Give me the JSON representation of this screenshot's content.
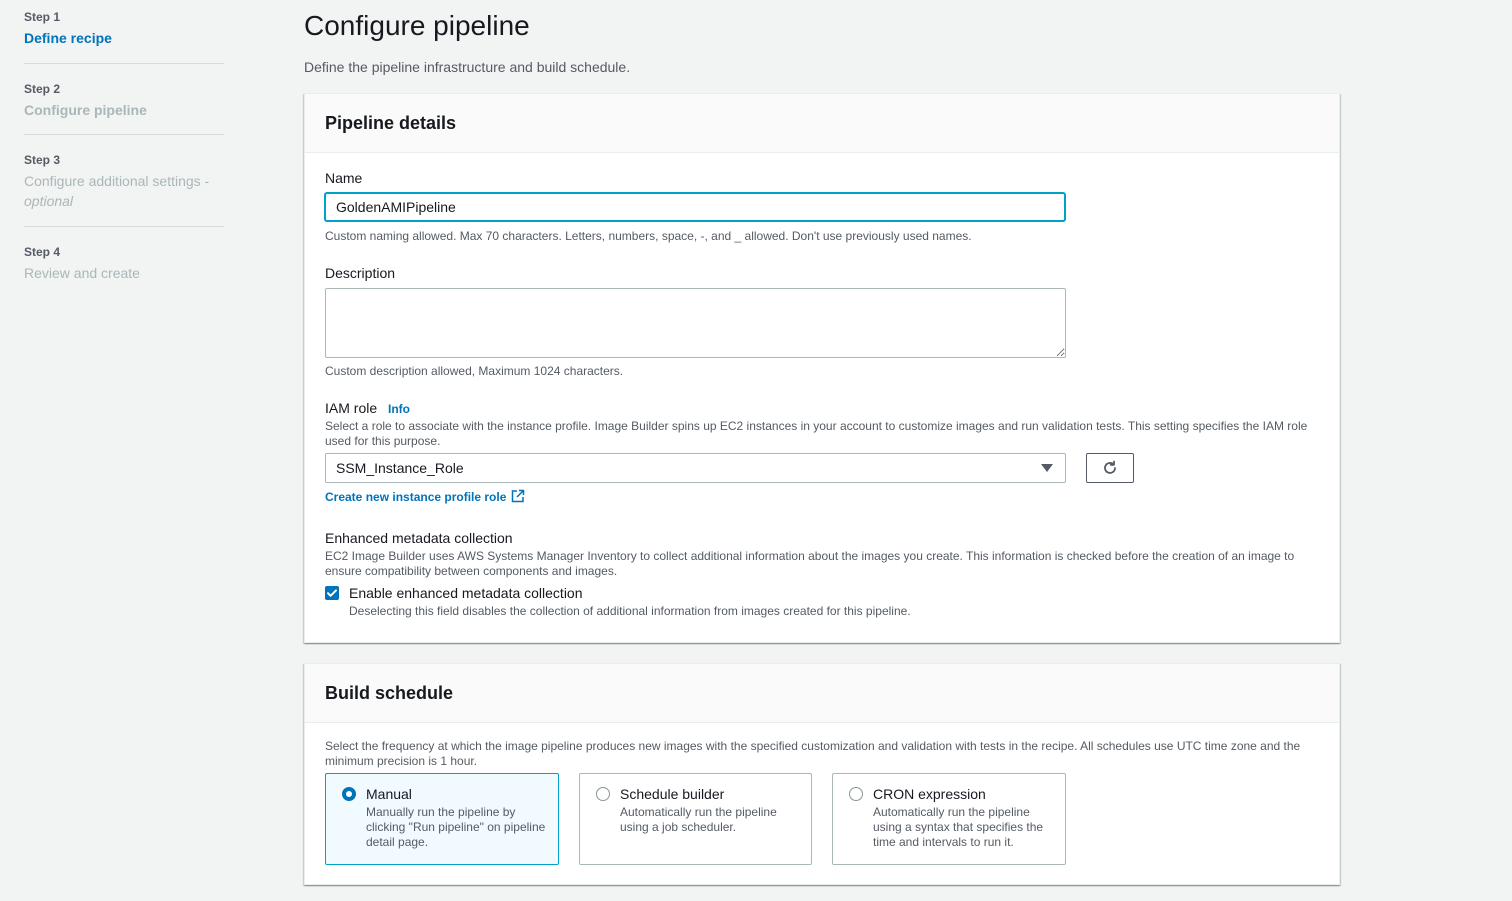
{
  "steps": [
    {
      "num": "Step 1",
      "title": "Define recipe",
      "optional": ""
    },
    {
      "num": "Step 2",
      "title": "Configure pipeline",
      "optional": ""
    },
    {
      "num": "Step 3",
      "title": "Configure additional settings -",
      "optional": "optional"
    },
    {
      "num": "Step 4",
      "title": "Review and create",
      "optional": ""
    }
  ],
  "header": {
    "title": "Configure pipeline",
    "subtitle": "Define the pipeline infrastructure and build schedule."
  },
  "pipeline_details": {
    "heading": "Pipeline details",
    "name_label": "Name",
    "name_value": "GoldenAMIPipeline",
    "name_hint": "Custom naming allowed. Max 70 characters. Letters, numbers, space, -, and _ allowed. Don't use previously used names.",
    "description_label": "Description",
    "description_value": "",
    "description_hint": "Custom description allowed, Maximum 1024 characters.",
    "iam_label": "IAM role",
    "iam_info": "Info",
    "iam_desc": "Select a role to associate with the instance profile. Image Builder spins up EC2 instances in your account to customize images and run validation tests. This setting specifies the IAM role used for this purpose.",
    "iam_selected": "SSM_Instance_Role",
    "create_role_link": "Create new instance profile role",
    "metadata_label": "Enhanced metadata collection",
    "metadata_desc": "EC2 Image Builder uses AWS Systems Manager Inventory to collect additional information about the images you create. This information is checked before the creation of an image to ensure compatibility between components and images.",
    "metadata_checkbox_label": "Enable enhanced metadata collection",
    "metadata_checked": true,
    "metadata_checkbox_desc": "Deselecting this field disables the collection of additional information from images created for this pipeline."
  },
  "build_schedule": {
    "heading": "Build schedule",
    "desc": "Select the frequency at which the image pipeline produces new images with the specified customization and validation with tests in the recipe. All schedules use UTC time zone and the minimum precision is 1 hour.",
    "options": [
      {
        "title": "Manual",
        "desc": "Manually run the pipeline by clicking \"Run pipeline\" on pipeline detail page.",
        "selected": true
      },
      {
        "title": "Schedule builder",
        "desc": "Automatically run the pipeline using a job scheduler.",
        "selected": false
      },
      {
        "title": "CRON expression",
        "desc": "Automatically run the pipeline using a syntax that specifies the time and intervals to run it.",
        "selected": false
      }
    ]
  },
  "colors": {
    "link": "#0073bb",
    "focus": "#00a1c9",
    "muted_step": "#aab7b8"
  },
  "icons": [
    "refresh-icon",
    "caret-down-icon",
    "external-link-icon",
    "checkmark-icon"
  ]
}
